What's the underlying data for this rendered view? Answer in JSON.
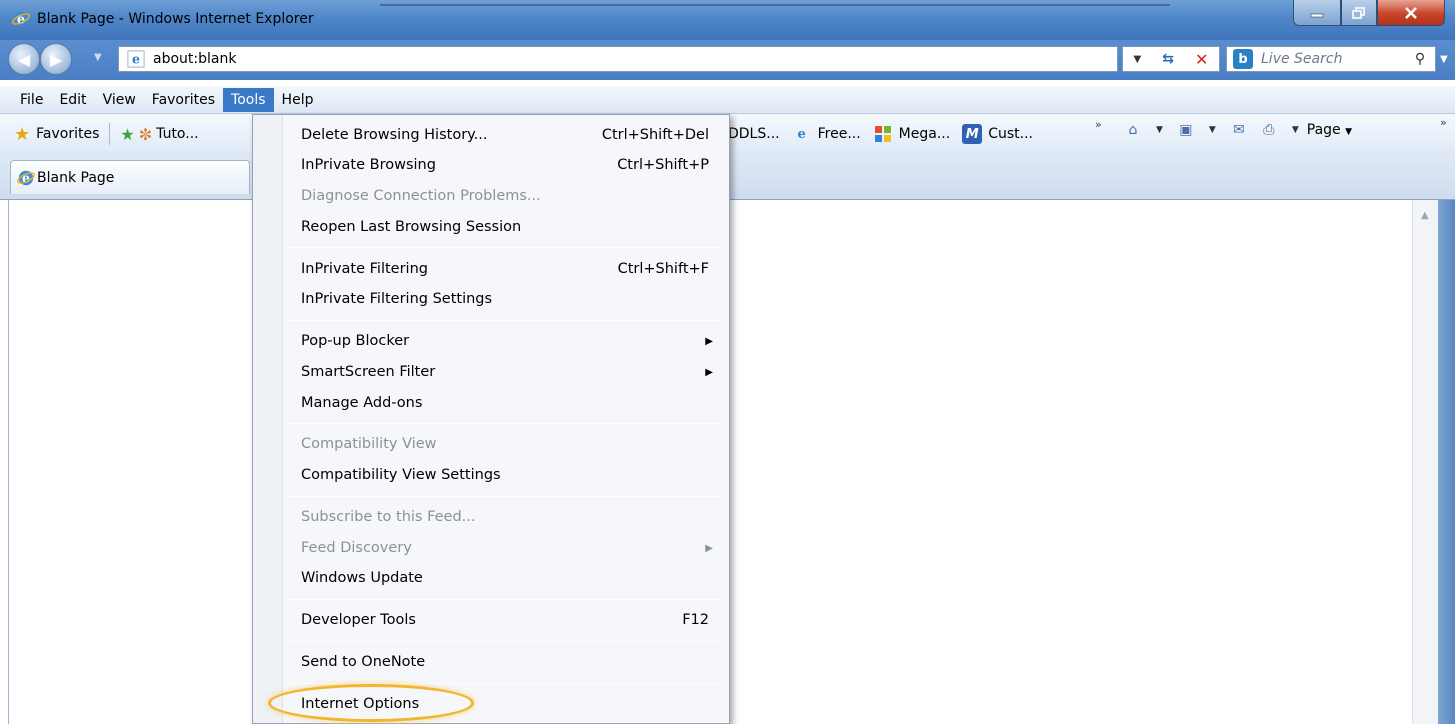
{
  "window": {
    "title": "Blank Page - Windows Internet Explorer"
  },
  "address": {
    "url": "about:blank"
  },
  "search": {
    "placeholder": "Live Search"
  },
  "menubar": [
    {
      "label": "File"
    },
    {
      "label": "Edit"
    },
    {
      "label": "View"
    },
    {
      "label": "Favorites"
    },
    {
      "label": "Tools"
    },
    {
      "label": "Help"
    }
  ],
  "favorites_bar": {
    "favorites_label": "Favorites",
    "links": [
      "Tuto...",
      "DDLS...",
      "Free...",
      "Mega...",
      "Cust..."
    ]
  },
  "command_bar": {
    "page_label": "Page"
  },
  "tab": {
    "label": "Blank Page"
  },
  "tools_menu": {
    "items": [
      {
        "label": "Delete Browsing History...",
        "shortcut": "Ctrl+Shift+Del",
        "enabled": true
      },
      {
        "label": "InPrivate Browsing",
        "shortcut": "Ctrl+Shift+P",
        "enabled": true
      },
      {
        "label": "Diagnose Connection Problems...",
        "shortcut": "",
        "enabled": false
      },
      {
        "label": "Reopen Last Browsing Session",
        "shortcut": "",
        "enabled": true
      },
      {
        "label": "InPrivate Filtering",
        "shortcut": "Ctrl+Shift+F",
        "enabled": true
      },
      {
        "label": "InPrivate Filtering Settings",
        "shortcut": "",
        "enabled": true
      },
      {
        "label": "Pop-up Blocker",
        "shortcut": "",
        "enabled": true,
        "submenu": true
      },
      {
        "label": "SmartScreen Filter",
        "shortcut": "",
        "enabled": true,
        "submenu": true
      },
      {
        "label": "Manage Add-ons",
        "shortcut": "",
        "enabled": true
      },
      {
        "label": "Compatibility View",
        "shortcut": "",
        "enabled": false
      },
      {
        "label": "Compatibility View Settings",
        "shortcut": "",
        "enabled": true
      },
      {
        "label": "Subscribe to this Feed...",
        "shortcut": "",
        "enabled": false
      },
      {
        "label": "Feed Discovery",
        "shortcut": "",
        "enabled": false,
        "submenu": true
      },
      {
        "label": "Windows Update",
        "shortcut": "",
        "enabled": true
      },
      {
        "label": "Developer Tools",
        "shortcut": "F12",
        "enabled": true
      },
      {
        "label": "Send to OneNote",
        "shortcut": "",
        "enabled": true
      },
      {
        "label": "Internet Options",
        "shortcut": "",
        "enabled": true,
        "highlighted": true
      }
    ]
  },
  "colors": {
    "titlebar": "#4f86c9",
    "menu_active": "#3a78c8",
    "highlight_ring": "#f2b52e"
  }
}
